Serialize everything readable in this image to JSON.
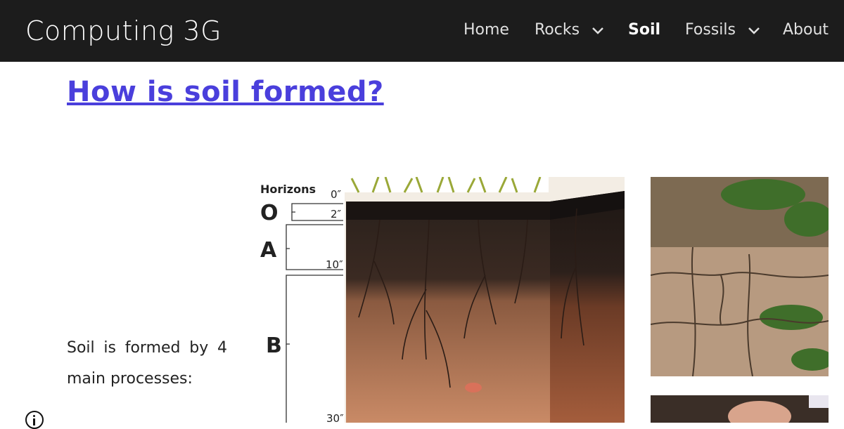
{
  "header": {
    "site_title": "Computing 3G",
    "nav": [
      {
        "label": "Home"
      },
      {
        "label": "Rocks"
      },
      {
        "label": "Soil"
      },
      {
        "label": "Fossils"
      },
      {
        "label": "About"
      }
    ]
  },
  "main": {
    "heading": "How is soil formed?",
    "body_text": "Soil is formed by 4 main processes:"
  },
  "diagram": {
    "horizons_label": "Horizons",
    "horizons": [
      "O",
      "A",
      "B"
    ],
    "depths": [
      "0″",
      "2″",
      "10″",
      "30″"
    ]
  },
  "colors": {
    "header_bg": "#1c1c1c",
    "heading_link": "#4a3fdc"
  }
}
